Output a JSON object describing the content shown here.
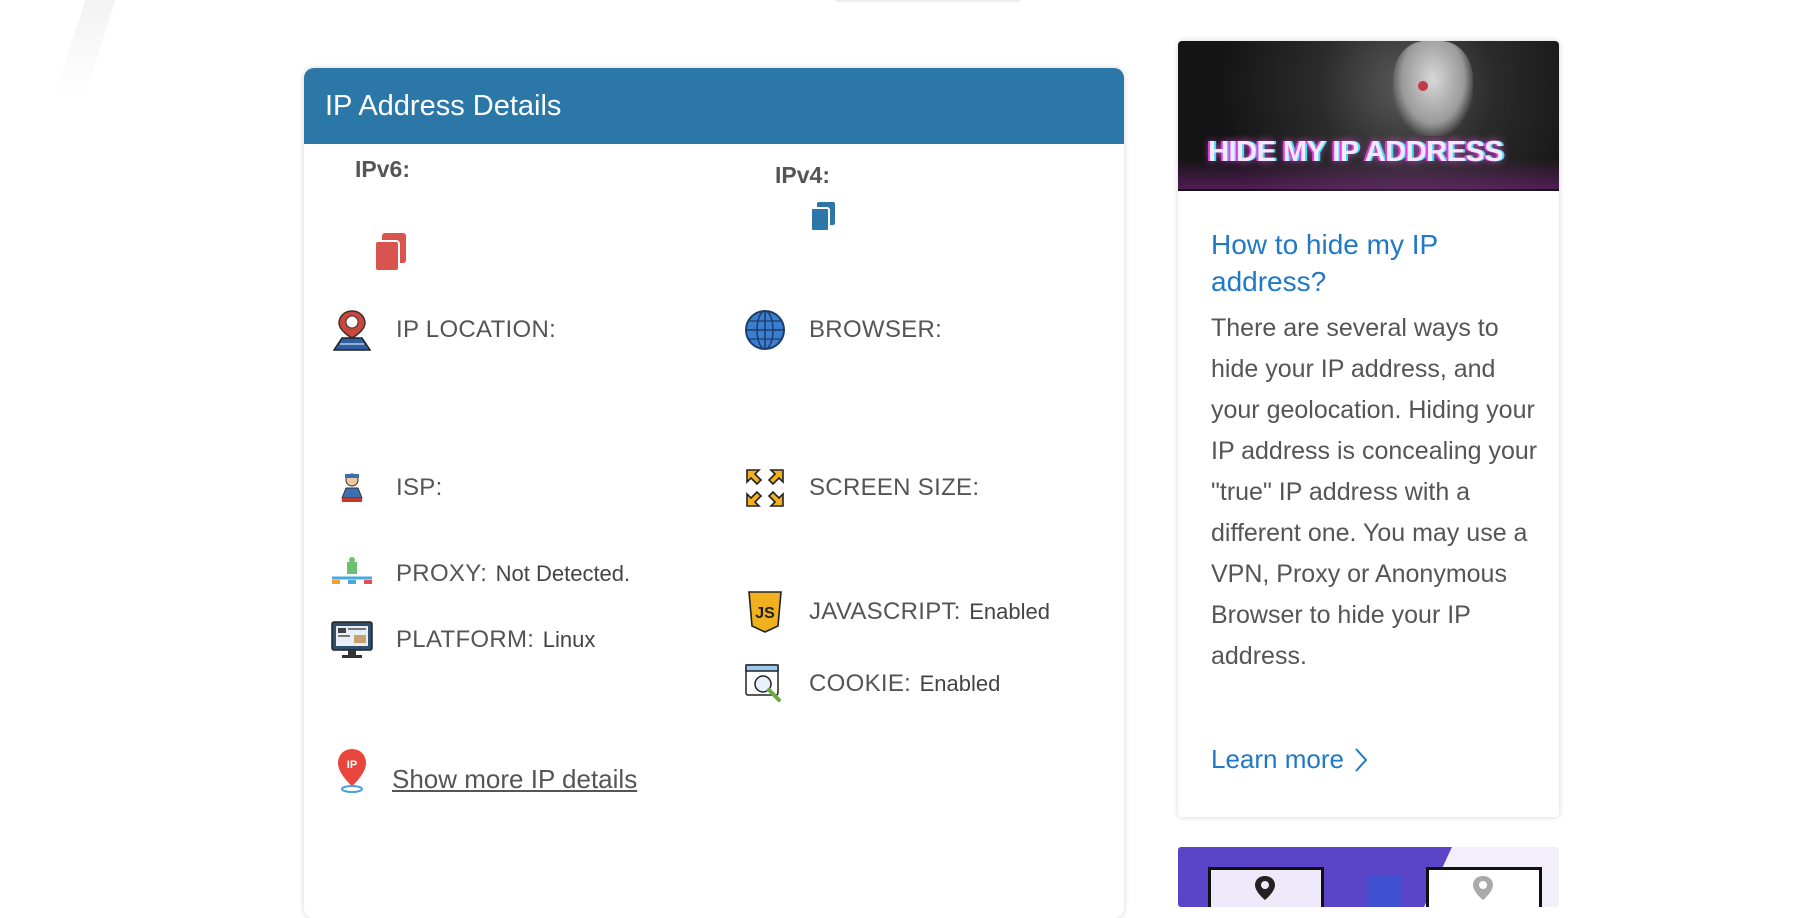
{
  "card": {
    "title": "IP Address Details",
    "ipv6_label": "IPv6:",
    "ipv4_label": "IPv4:",
    "items": {
      "ip_location": {
        "label": "IP LOCATION:",
        "value": ""
      },
      "browser": {
        "label": "BROWSER:",
        "value": ""
      },
      "isp": {
        "label": "ISP:",
        "value": ""
      },
      "screen_size": {
        "label": "SCREEN SIZE:",
        "value": ""
      },
      "proxy": {
        "label": "PROXY:",
        "value": "Not Detected."
      },
      "javascript": {
        "label": "JAVASCRIPT:",
        "value": "Enabled"
      },
      "platform": {
        "label": "PLATFORM:",
        "value": "Linux"
      },
      "cookie": {
        "label": "COOKIE:",
        "value": "Enabled"
      }
    },
    "more_link": "Show more IP details"
  },
  "article": {
    "banner_text": "HIDE MY IP ADDRESS",
    "title": "How to hide my IP address?",
    "body": "There are several ways to hide your IP address, and your geolocation. Hiding your IP address is concealing your \"true\" IP address with a different one. You may use a VPN, Proxy or Anonymous Browser to hide your IP address.",
    "learn_more": "Learn more"
  },
  "colors": {
    "header_blue": "#2a77a8",
    "link_blue": "#1f78c8",
    "copy_red": "#d9534f",
    "copy_blue": "#2a77a8",
    "promo_purple": "#5a45c9"
  },
  "icons": {
    "copy_ipv6": "copy-icon",
    "copy_ipv4": "copy-icon",
    "ip_location": "location-pin-icon",
    "browser": "globe-icon",
    "isp": "isp-person-icon",
    "screen_size": "expand-arrows-icon",
    "proxy": "network-proxy-icon",
    "javascript": "js-shield-icon",
    "platform": "monitor-icon",
    "cookie": "cookie-search-icon",
    "more": "ip-pin-icon"
  }
}
